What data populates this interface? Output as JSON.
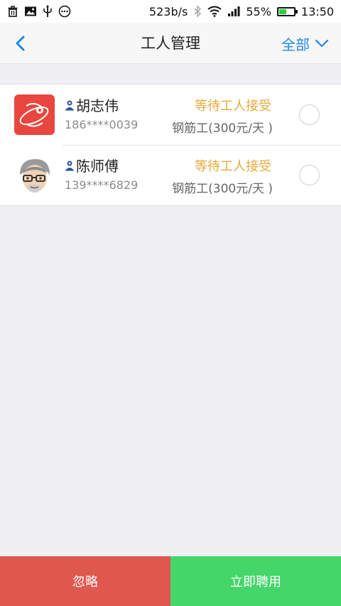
{
  "status_bar": {
    "net_speed": "523b/s",
    "battery_percent": "55%",
    "battery_level": 55,
    "time": "13:50",
    "icons_left": [
      "trash-icon",
      "image-icon",
      "usb-icon",
      "more-dots-icon"
    ],
    "icons_right": [
      "bluetooth-icon",
      "wifi-icon",
      "signal-icon",
      "battery-icon"
    ]
  },
  "header": {
    "title": "工人管理",
    "filter_label": "全部"
  },
  "workers": [
    {
      "name": "胡志伟",
      "phone": "186****0039",
      "status": "等待工人接受",
      "job": "钢筋工(300元/天 )",
      "avatar": "red-logo-avatar"
    },
    {
      "name": "陈师傅",
      "phone": "139****6829",
      "status": "等待工人接受",
      "job": "钢筋工(300元/天 )",
      "avatar": "cartoon-man-avatar"
    }
  ],
  "actions": {
    "ignore_label": "忽略",
    "hire_label": "立即聘用"
  },
  "colors": {
    "accent": "#1e88e5",
    "status": "#e9a93a",
    "ignore": "#e0574e",
    "hire": "#45d66a"
  }
}
